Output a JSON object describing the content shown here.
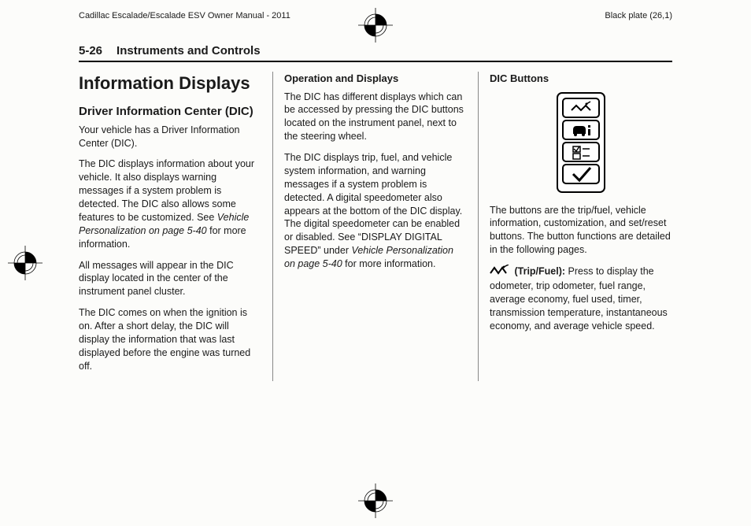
{
  "top": {
    "manual_title": "Cadillac Escalade/Escalade ESV Owner Manual - 2011",
    "plate": "Black plate (26,1)"
  },
  "header": {
    "page_number": "5-26",
    "section_title": "Instruments and Controls"
  },
  "col1": {
    "h1": "Information Displays",
    "h2": "Driver Information Center (DIC)",
    "p1": "Your vehicle has a Driver Information Center (DIC).",
    "p2a": "The DIC displays information about your vehicle. It also displays warning messages if a system problem is detected. The DIC also allows some features to be customized. See ",
    "p2b": "Vehicle Personalization on page 5-40",
    "p2c": " for more information.",
    "p3": "All messages will appear in the DIC display located in the center of the instrument panel cluster.",
    "p4": "The DIC comes on when the ignition is on. After a short delay, the DIC will display the information that was last displayed before the engine was turned off."
  },
  "col2": {
    "h3": "Operation and Displays",
    "p1": "The DIC has different displays which can be accessed by pressing the DIC buttons located on the instrument panel, next to the steering wheel.",
    "p2a": "The DIC displays trip, fuel, and vehicle system information, and warning messages if a system problem is detected. A digital speedometer also appears at the bottom of the DIC display. The digital speedometer can be enabled or disabled. See “DISPLAY DIGITAL SPEED” under ",
    "p2b": "Vehicle Personalization on page 5-40",
    "p2c": " for more information."
  },
  "col3": {
    "h3": "DIC Buttons",
    "p1": "The buttons are the trip/fuel, vehicle information, customization, and set/reset buttons. The button functions are detailed in the following pages.",
    "trip_label": " (Trip/Fuel):",
    "trip_text": "  Press to display the odometer, trip odometer, fuel range, average economy, fuel used, timer, transmission temperature, instantaneous economy, and average vehicle speed."
  }
}
